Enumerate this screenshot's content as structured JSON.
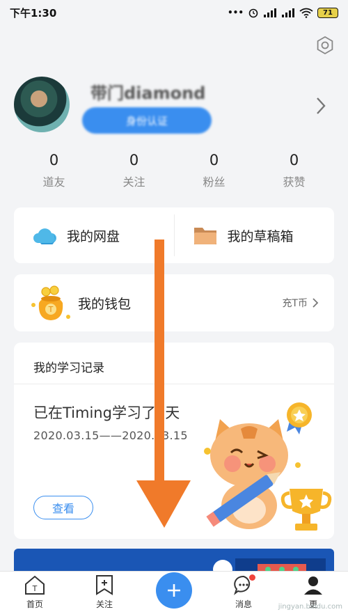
{
  "status_bar": {
    "time": "下午1:30",
    "signal_text": "•••",
    "battery": "71"
  },
  "profile": {
    "username": "带门diamond",
    "verify_label": "身份认证"
  },
  "stats": [
    {
      "count": "0",
      "label": "道友"
    },
    {
      "count": "0",
      "label": "关注"
    },
    {
      "count": "0",
      "label": "粉丝"
    },
    {
      "count": "0",
      "label": "获赞"
    }
  ],
  "storage": {
    "disk_label": "我的网盘",
    "drafts_label": "我的草稿箱"
  },
  "wallet": {
    "label": "我的钱包",
    "recharge_label": "充T币"
  },
  "study": {
    "title": "我的学习记录",
    "headline": "已在Timing学习了1天",
    "date_range": "2020.03.15——2020.03.15",
    "view_label": "查看"
  },
  "tabbar": {
    "home_label": "首页",
    "follow_label": "关注",
    "messages_label": "消息",
    "more_label": "更"
  },
  "watermark": "jingyan.baidu.com",
  "colors": {
    "accent": "#3a8eef",
    "arrow": "#f07a2a",
    "badge": "#f0443c"
  }
}
